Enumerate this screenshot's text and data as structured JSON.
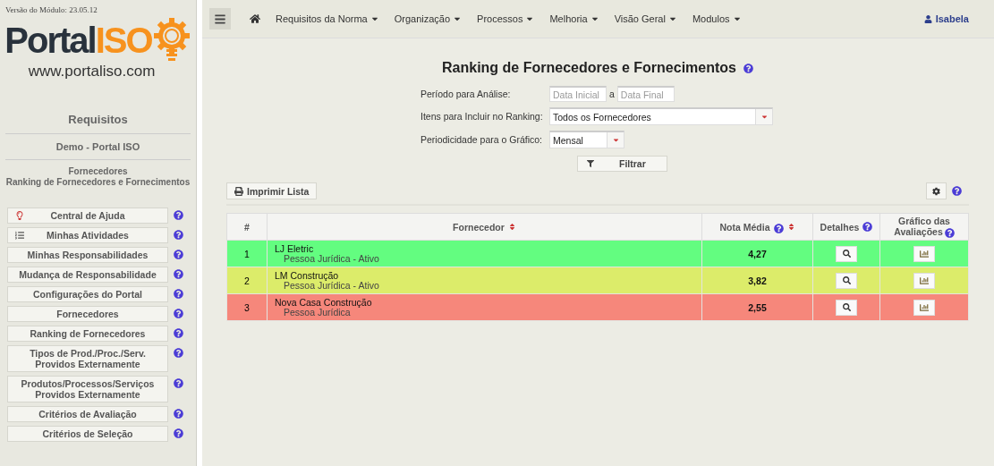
{
  "sidebar": {
    "version": "Versão do Módulo: 23.05.12",
    "logo": {
      "word": "Portal",
      "accent": "ISO",
      "url": "www.portaliso.com"
    },
    "section": "Requisitos",
    "company": "Demo - Portal ISO",
    "breadcrumb": [
      "Fornecedores",
      "Ranking de Fornecedores e Fornecimentos"
    ],
    "items": [
      {
        "label": "Central de Ajuda"
      },
      {
        "label": "Minhas Atividades"
      },
      {
        "label": "Minhas Responsabilidades"
      },
      {
        "label": "Mudança de Responsabilidade"
      },
      {
        "label": "Configurações do Portal"
      },
      {
        "label": "Fornecedores"
      },
      {
        "label": "Ranking de Fornecedores"
      },
      {
        "label": "Tipos de Prod./Proc./Serv.\nProvidos Externamente"
      },
      {
        "label": "Produtos/Processos/Serviços\nProvidos Externamente"
      },
      {
        "label": "Critérios de Avaliação"
      },
      {
        "label": "Critérios de Seleção"
      }
    ]
  },
  "navbar": {
    "menus": [
      "Requisitos da Norma",
      "Organização",
      "Processos",
      "Melhoria",
      "Visão Geral",
      "Modulos"
    ],
    "user": "Isabela"
  },
  "page": {
    "title": "Ranking de Fornecedores e Fornecimentos",
    "period": {
      "label": "Período para Análise:",
      "start_placeholder": "Data Inicial",
      "separator": "a",
      "end_placeholder": "Data Final"
    },
    "items_filter": {
      "label": "Itens para Incluir no Ranking:",
      "value": "Todos os Fornecedores"
    },
    "frequency": {
      "label": "Periodicidade para o Gráfico:",
      "value": "Mensal"
    },
    "filter_button": "Filtrar",
    "print_button": "Imprimir Lista"
  },
  "table": {
    "columns": [
      "#",
      "Fornecedor",
      "Nota Média",
      "Detalhes",
      "Gráfico das Avaliações"
    ],
    "rows": [
      {
        "rank": "1",
        "name": "LJ Eletric",
        "detail": "Pessoa Jurídica - Ativo",
        "score": "4,27",
        "color": "#63fd80"
      },
      {
        "rank": "2",
        "name": "LM Construção",
        "detail": "Pessoa Jurídica - Ativo",
        "score": "3,82",
        "color": "#dcec6a"
      },
      {
        "rank": "3",
        "name": "Nova Casa Construção",
        "detail": "Pessoa Jurídica",
        "score": "2,55",
        "color": "#f6877b"
      }
    ]
  }
}
